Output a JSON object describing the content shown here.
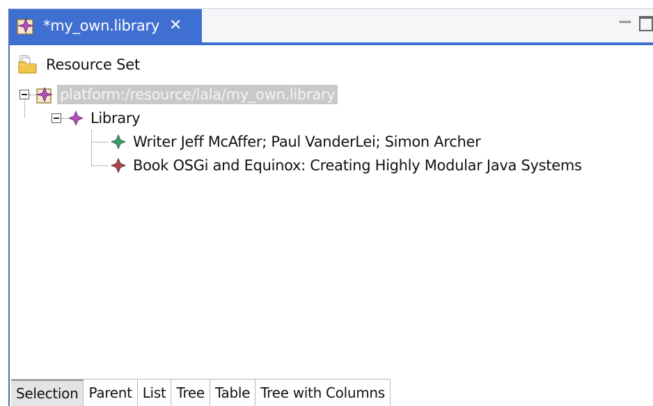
{
  "editor": {
    "tab_title": "*my_own.library",
    "close_glyph": "✕",
    "tab_icon": "library-model-icon"
  },
  "view_controls": {
    "minimize": "minimize-icon",
    "maximize": "maximize-icon"
  },
  "tree": {
    "root_label": "Resource Set",
    "root_icon": "resource-set-folder-icon",
    "resource": {
      "label": "platform:/resource/lala/my_own.library",
      "icon": "library-model-icon",
      "selected": true
    },
    "library": {
      "label": "Library",
      "icon": "library-diamond-icon",
      "children": [
        {
          "label": "Writer Jeff McAffer; Paul VanderLei; Simon Archer",
          "icon": "writer-diamond-icon",
          "color": "#3d9a6a"
        },
        {
          "label": "Book OSGi and Equinox: Creating Highly Modular Java Systems",
          "icon": "book-diamond-icon",
          "color": "#a84a4a"
        }
      ]
    }
  },
  "bottom_tabs": [
    "Selection",
    "Parent",
    "List",
    "Tree",
    "Table",
    "Tree with Columns"
  ],
  "active_bottom_tab": "Selection",
  "colors": {
    "tab_active_bg": "#3e6fd1",
    "selection_bg": "#c9c9c9",
    "library_diamond": "#b04fb6"
  }
}
